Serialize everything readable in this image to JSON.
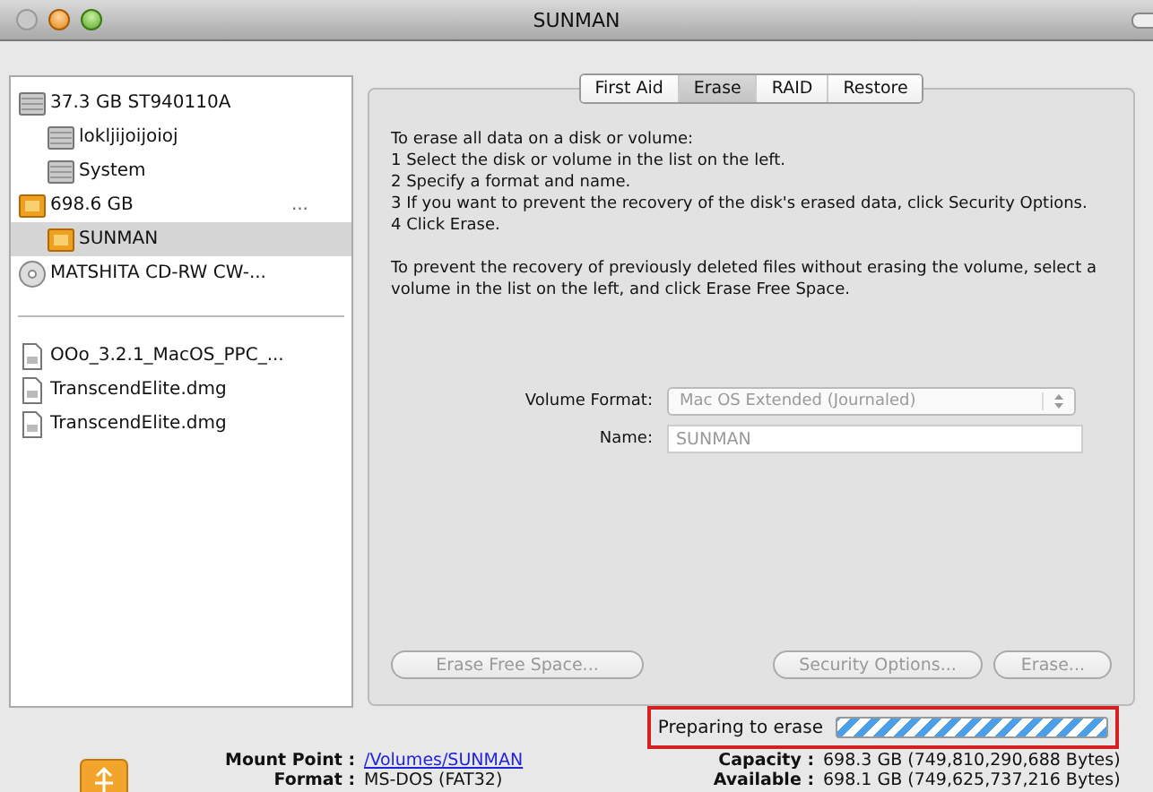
{
  "window": {
    "title": "SUNMAN"
  },
  "sidebar": {
    "items": [
      {
        "label": "37.3 GB ST940110A",
        "kind": "hdd",
        "selected": false,
        "children": [
          {
            "label": "lokljijoijoioj",
            "kind": "hdd",
            "selected": false
          },
          {
            "label": "System",
            "kind": "hdd",
            "selected": false
          }
        ]
      },
      {
        "label": "698.6 GB",
        "suffix": "...",
        "kind": "usb",
        "selected": false,
        "children": [
          {
            "label": "SUNMAN",
            "kind": "usb",
            "selected": true
          }
        ]
      },
      {
        "label": "MATSHITA CD-RW CW-...",
        "kind": "cd",
        "selected": false
      }
    ],
    "images": [
      {
        "label": "OOo_3.2.1_MacOS_PPC_...",
        "kind": "dmg",
        "selected": false
      },
      {
        "label": "TranscendElite.dmg",
        "kind": "dmg",
        "selected": false
      },
      {
        "label": "TranscendElite.dmg",
        "kind": "dmg",
        "selected": false
      }
    ]
  },
  "tabs": [
    {
      "label": "First Aid",
      "selected": false
    },
    {
      "label": "Erase",
      "selected": true
    },
    {
      "label": "RAID",
      "selected": false
    },
    {
      "label": "Restore",
      "selected": false
    }
  ],
  "instructions": [
    "To erase all data on a disk or volume:",
    "1 Select the disk or volume in the list on the left.",
    "2 Specify a format and name.",
    "3 If you want to prevent the recovery of the disk's erased data, click Security Options.",
    "4 Click Erase."
  ],
  "note": "To prevent the recovery of previously deleted files without erasing the volume, select a volume in the list on the left, and click Erase Free Space.",
  "volume_format": {
    "label": "Volume Format:",
    "value": "Mac OS Extended (Journaled)",
    "disabled": true
  },
  "name": {
    "label": "Name:",
    "value": "SUNMAN",
    "disabled": true
  },
  "buttons": [
    {
      "label": "Erase Free Space...",
      "disabled": true
    },
    {
      "label": "Security Options...",
      "disabled": true
    },
    {
      "label": "Erase...",
      "disabled": true
    }
  ],
  "progress": {
    "label": "Preparing to erase",
    "indeterminate": true
  },
  "info": [
    {
      "label": "Mount Point :",
      "value": "/Volumes/SUNMAN",
      "kind": "link"
    },
    {
      "label": "Capacity :",
      "value": "698.3 GB (749,810,290,688 Bytes)",
      "kind": "text"
    },
    {
      "label": "Format :",
      "value": "MS-DOS (FAT32)",
      "kind": "text"
    },
    {
      "label": "Available :",
      "value": "698.1 GB (749,625,737,216 Bytes)",
      "kind": "text"
    }
  ]
}
